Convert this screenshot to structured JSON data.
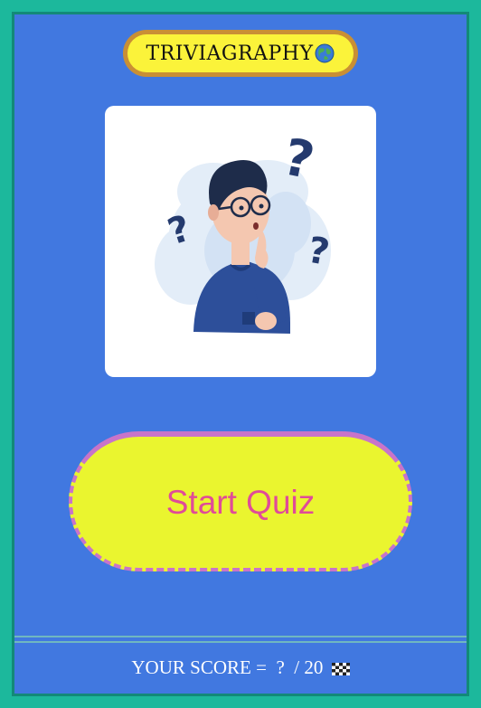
{
  "header": {
    "title": "TRIVIAGRAPHY",
    "title_icon": "globe-icon"
  },
  "hero": {
    "image": "confused-person-with-question-marks-illustration"
  },
  "start_button": {
    "label": "Start Quiz"
  },
  "footer": {
    "score_prefix": "YOUR SCORE =",
    "score_value": "?",
    "score_total": "/ 20",
    "score_icon": "checkered-flag-icon"
  },
  "colors": {
    "frame": "#1cb89c",
    "panel": "#4178e0",
    "pill": "#fbf33a",
    "pill_border": "#c98f35",
    "button": "#eaf52f",
    "button_border": "#c874c9",
    "button_text": "#e04b98",
    "person_sweater": "#2d4f9a",
    "question_marks": "#243a6e"
  }
}
